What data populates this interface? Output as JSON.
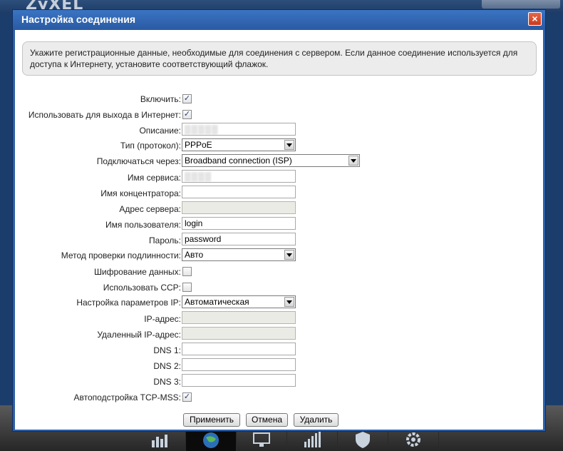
{
  "window": {
    "title": "Настройка соединения",
    "close_symbol": "×"
  },
  "info_text": "Укажите регистрационные данные, необходимые для соединения с сервером. Если данное соединение используется для доступа к Интернету, установите соответствующий флажок.",
  "form": {
    "enable": {
      "label": "Включить:",
      "checked": true
    },
    "use_for_internet": {
      "label": "Использовать для выхода в Интернет:",
      "checked": true
    },
    "description": {
      "label": "Описание:",
      "value": ""
    },
    "protocol": {
      "label": "Тип (протокол):",
      "value": "PPPoE"
    },
    "connect_via": {
      "label": "Подключаться через:",
      "value": "Broadband connection (ISP)"
    },
    "service_name": {
      "label": "Имя сервиса:",
      "value": ""
    },
    "concentrator_name": {
      "label": "Имя концентратора:",
      "value": ""
    },
    "server_address": {
      "label": "Адрес сервера:",
      "value": ""
    },
    "username": {
      "label": "Имя пользователя:",
      "value": "login"
    },
    "password": {
      "label": "Пароль:",
      "value": "password"
    },
    "auth_method": {
      "label": "Метод проверки подлинности:",
      "value": "Авто"
    },
    "data_encryption": {
      "label": "Шифрование данных:",
      "checked": false
    },
    "use_ccp": {
      "label": "Использовать CCP:",
      "checked": false
    },
    "ip_settings": {
      "label": "Настройка параметров IP:",
      "value": "Автоматическая"
    },
    "ip_address": {
      "label": "IP-адрес:",
      "value": ""
    },
    "remote_ip": {
      "label": "Удаленный IP-адрес:",
      "value": ""
    },
    "dns1": {
      "label": "DNS 1:",
      "value": ""
    },
    "dns2": {
      "label": "DNS 2:",
      "value": ""
    },
    "dns3": {
      "label": "DNS 3:",
      "value": ""
    },
    "tcp_mss": {
      "label": "Автоподстройка TCP-MSS:",
      "checked": true
    }
  },
  "buttons": {
    "apply": "Применить",
    "cancel": "Отмена",
    "delete": "Удалить"
  },
  "colors": {
    "title_bar": "#2d5fa8",
    "close_button": "#d9472b"
  },
  "background": {
    "logo_text": "ZyXEL",
    "taskbar_icons": [
      "chart-icon",
      "globe-icon",
      "monitor-icon",
      "signal-icon",
      "shield-icon",
      "gear-icon"
    ]
  }
}
